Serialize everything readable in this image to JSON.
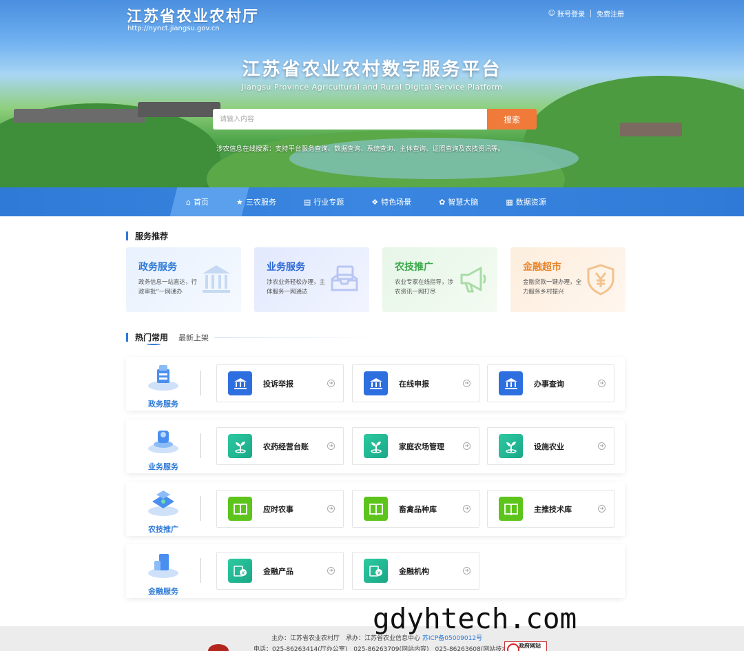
{
  "header": {
    "logo_title": "江苏省农业农村厅",
    "logo_url": "http://nynct.jiangsu.gov.cn",
    "login": "账号登录",
    "register": "免费注册"
  },
  "hero": {
    "title": "江苏省农业农村数字服务平台",
    "subtitle": "Jiangsu Province Agricultural and Rural Digital Service Platform",
    "search_placeholder": "请输入内容",
    "search_button": "搜索",
    "search_hint": "涉农信息在线搜索：支持平台服务查询、数据查询、系统查询、主体查询、证照查询及农技资讯等。"
  },
  "nav": {
    "items": [
      {
        "label": "首页",
        "icon": "home-icon",
        "active": true
      },
      {
        "label": "三农服务",
        "icon": "star-icon"
      },
      {
        "label": "行业专题",
        "icon": "clipboard-icon"
      },
      {
        "label": "特色场景",
        "icon": "grid-icon"
      },
      {
        "label": "智慧大脑",
        "icon": "brain-icon"
      },
      {
        "label": "数据资源",
        "icon": "chart-icon"
      }
    ]
  },
  "recommend": {
    "title": "服务推荐",
    "cards": [
      {
        "title": "政务服务",
        "desc": "政务信息一站直达，行政审批“一网通办",
        "icon": "government-building-icon",
        "color": "#2e7ad6"
      },
      {
        "title": "业务服务",
        "desc": "涉农业务轻松办理，主体服务一网通达",
        "icon": "inbox-icon",
        "color": "#2e6ad6"
      },
      {
        "title": "农技推广",
        "desc": "农业专家在线指导，涉农资讯一网打尽",
        "icon": "megaphone-icon",
        "color": "#3aa84a"
      },
      {
        "title": "金融超市",
        "desc": "金融贷款一键办理，全力服务乡村振兴",
        "icon": "yuan-shield-icon",
        "color": "#e8862e"
      }
    ]
  },
  "hot": {
    "title": "热门常用",
    "tab2": "最新上架",
    "rows": [
      {
        "category": "政务服务",
        "items": [
          "投诉举报",
          "在线申报",
          "办事查询"
        ]
      },
      {
        "category": "业务服务",
        "items": [
          "农药经营台账",
          "家庭农场管理",
          "设施农业"
        ]
      },
      {
        "category": "农技推广",
        "items": [
          "应时农事",
          "畜禽品种库",
          "主推技术库"
        ]
      },
      {
        "category": "金融服务",
        "items": [
          "金融产品",
          "金融机构"
        ]
      }
    ]
  },
  "footer": {
    "line1_a": "主办：江苏省农业农村厅　承办：江苏省农业信息中心",
    "line1_icp": "苏ICP备05009012号",
    "line2": "电话：025-86263414(厅办公室)　025-86263709(网站内容)　025-86263608(网站技术)",
    "gov_badge": "政府网站"
  },
  "watermark": "gdyhtech.com"
}
